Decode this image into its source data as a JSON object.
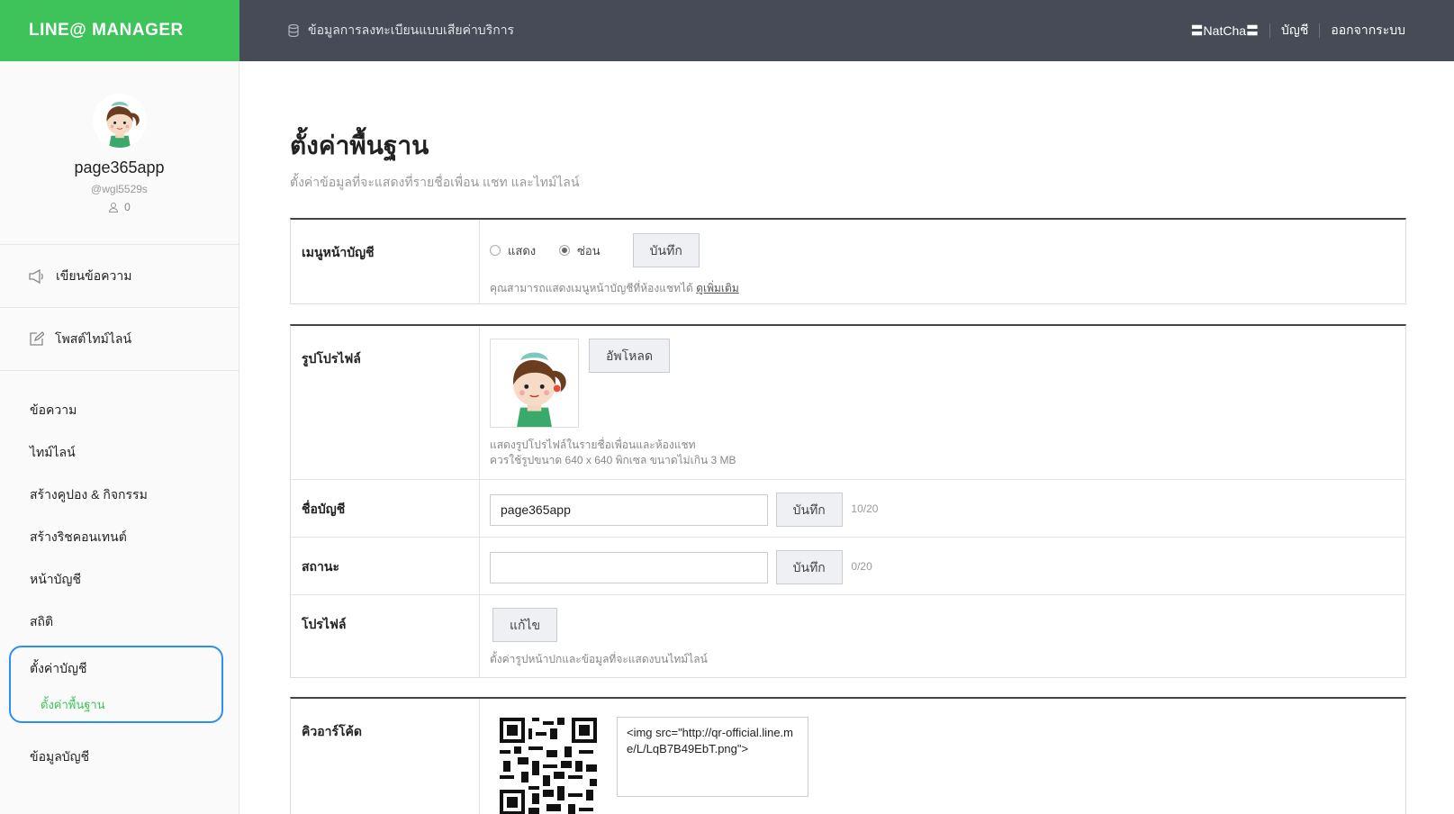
{
  "header": {
    "brand": "LINE@ MANAGER",
    "info": "ข้อมูลการลงทะเบียนแบบเสียค่าบริการ",
    "user": "〓NatCha〓",
    "account": "บัญชี",
    "logout": "ออกจากระบบ"
  },
  "sidebar": {
    "name": "page365app",
    "id": "@wgl5529s",
    "friends": "0",
    "write_message": "เขียนข้อความ",
    "post_timeline": "โพสต์ไทม์ไลน์",
    "nav": [
      "ข้อความ",
      "ไทม์ไลน์",
      "สร้างคูปอง & กิจกรรม",
      "สร้างริชคอนเทนต์",
      "หน้าบัญชี",
      "สถิติ"
    ],
    "settings": "ตั้งค่าบัญชี",
    "settings_basic": "ตั้งค่าพื้นฐาน",
    "account_info": "ข้อมูลบัญชี"
  },
  "page": {
    "title": "ตั้งค่าพื้นฐาน",
    "subtitle": "ตั้งค่าข้อมูลที่จะแสดงที่รายชื่อเพื่อน แชท และไทม์ไลน์"
  },
  "menu_section": {
    "label": "เมนูหน้าบัญชี",
    "show": "แสดง",
    "hide": "ซ่อน",
    "selected": "hide",
    "save": "บันทึก",
    "hint": "คุณสามารถแสดงเมนูหน้าบัญชีที่ห้องแชทได้",
    "hint_link": "ดูเพิ่มเติม"
  },
  "profile_section": {
    "photo_label": "รูปโปรไฟล์",
    "upload": "อัพโหลด",
    "photo_hint1": "แสดงรูปโปรไฟล์ในรายชื่อเพื่อนและห้องแชท",
    "photo_hint2": "ควรใช้รูปขนาด 640 x 640 พิกเซล ขนาดไม่เกิน 3 MB",
    "name_label": "ชื่อบัญชี",
    "name_value": "page365app",
    "name_save": "บันทึก",
    "name_count": "10/20",
    "status_label": "สถานะ",
    "status_value": "",
    "status_save": "บันทึก",
    "status_count": "0/20",
    "profile_label": "โปรไฟล์",
    "edit": "แก้ไข",
    "profile_hint": "ตั้งค่ารูปหน้าปกและข้อมูลที่จะแสดงบนไทม์ไลน์"
  },
  "qr_section": {
    "label": "คิวอาร์โค้ด",
    "code": "<img src=\"http://qr-official.line.me/L/LqB7B49EbT.png\">"
  },
  "colors": {
    "brand_green": "#3ec35b",
    "topbar": "#464b57",
    "highlight": "#2b8ff3"
  }
}
